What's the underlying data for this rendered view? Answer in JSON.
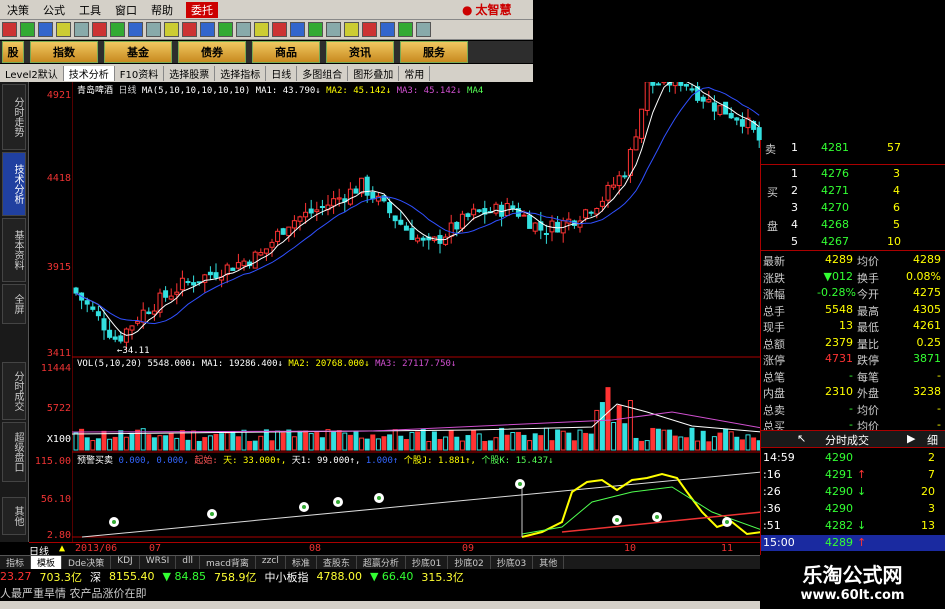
{
  "menu": {
    "items": [
      "决策",
      "公式",
      "工具",
      "窗口",
      "帮助"
    ],
    "highlight": "委托",
    "brand": "太智慧"
  },
  "nav": {
    "buttons": [
      "股",
      "指数",
      "基金",
      "债券",
      "商品",
      "资讯",
      "服务"
    ]
  },
  "tabs": {
    "items": [
      "Level2默认",
      "技术分析",
      "F10资料",
      "选择股票",
      "选择指标",
      "日线",
      "多图组合",
      "图形叠加",
      "常用"
    ]
  },
  "left_tabs": [
    "分时走势",
    "技术分析",
    "基本资料",
    "全屏",
    "分时成交",
    "超级盘口",
    "其他"
  ],
  "price_axis": {
    "labels": [
      "4921",
      "4418",
      "3915",
      "3411"
    ],
    "vol_labels": [
      "11444",
      "5722",
      "X100"
    ],
    "ind_labels": [
      "115.00",
      "56.10",
      "2.80"
    ]
  },
  "main_legend": {
    "name": "青岛啤酒",
    "period": "日线",
    "ma_def": "MA(5,10,10,10,10,10)",
    "ma1": "MA1: 43.790↓",
    "ma2": "MA2: 45.142↓",
    "ma3": "MA3: 45.142↓",
    "ma4": "MA4"
  },
  "low_label": "34.11",
  "vol_legend": {
    "def": "VOL(5,10,20)",
    "v": "5548.000↓",
    "ma1": "MA1: 19286.400↓",
    "ma2": "MA2: 20768.000↓",
    "ma3": "MA3: 27117.750↓"
  },
  "ind_legend": {
    "name": "预警买卖",
    "v1": "0.000, 0.000,",
    "v2": "起始:",
    "v3": "天: 33.000↑,",
    "v4": "天1: 99.000↑,",
    "v5": "1.000↑",
    "v6": "个股J: 1.881↑,",
    "v7": "个股K: 15.437↓"
  },
  "date_axis": {
    "label": "日线",
    "dates": [
      "2013/06",
      "07",
      "08",
      "09",
      "10",
      "11"
    ]
  },
  "orderbook": {
    "asks": [
      {
        "n": "1",
        "p": "4281",
        "v": "57"
      }
    ],
    "bids": [
      {
        "n": "1",
        "p": "4276",
        "v": "3"
      },
      {
        "n": "2",
        "p": "4271",
        "v": "4"
      },
      {
        "n": "3",
        "p": "4270",
        "v": "6"
      },
      {
        "n": "4",
        "p": "4268",
        "v": "5"
      },
      {
        "n": "5",
        "p": "4267",
        "v": "10"
      }
    ],
    "sell_label": "卖",
    "buy_label": "买",
    "plate_label": "盘"
  },
  "quote": [
    {
      "k": "最新",
      "v": "4289",
      "k2": "均价",
      "v2": "4289"
    },
    {
      "k": "涨跌",
      "v": "▼012",
      "k2": "换手",
      "v2": "0.08%"
    },
    {
      "k": "涨幅",
      "v": "-0.28%",
      "k2": "今开",
      "v2": "4275"
    },
    {
      "k": "总手",
      "v": "5548",
      "k2": "最高",
      "v2": "4305"
    },
    {
      "k": "现手",
      "v": "13",
      "k2": "最低",
      "v2": "4261"
    },
    {
      "k": "总额",
      "v": "2379",
      "k2": "量比",
      "v2": "0.25"
    },
    {
      "k": "涨停",
      "v": "4731",
      "k2": "跌停",
      "v2": "3871"
    },
    {
      "k": "总笔",
      "v": "-",
      "k2": "每笔",
      "v2": "-"
    },
    {
      "k": "内盘",
      "v": "2310",
      "k2": "外盘",
      "v2": "3238"
    },
    {
      "k": "总卖",
      "v": "-",
      "k2": "均价",
      "v2": "-"
    },
    {
      "k": "总买",
      "v": "-",
      "k2": "均价",
      "v2": "-"
    }
  ],
  "ticks_header": {
    "title": "分时成交",
    "next": "▶",
    "detail": "细"
  },
  "ticks": [
    {
      "t": "14:59",
      "p": "4290",
      "d": "",
      "v": "2"
    },
    {
      "t": ":16",
      "p": "4291",
      "d": "↑",
      "v": "7"
    },
    {
      "t": ":26",
      "p": "4290",
      "d": "↓",
      "v": "20"
    },
    {
      "t": ":36",
      "p": "4290",
      "d": "",
      "v": "3"
    },
    {
      "t": ":51",
      "p": "4282",
      "d": "↓",
      "v": "13"
    },
    {
      "t": "15:00",
      "p": "4289",
      "d": "↑",
      "v": ""
    }
  ],
  "bottom_tabs": [
    "指标",
    "模板",
    "Dde决策",
    "KDJ",
    "WRSI",
    "dll",
    "macd背离",
    "zzcl",
    "标准",
    "查股东",
    "超赢分析",
    "抄底01",
    "抄底02",
    "抄底03",
    "其他"
  ],
  "ticker": [
    {
      "v": "23.27",
      "c": "#f33"
    },
    {
      "v": "703.3亿",
      "c": "#ff3"
    },
    {
      "v": "深",
      "c": "#fff"
    },
    {
      "v": "8155.40",
      "c": "#ff3"
    },
    {
      "v": "▼ 84.85",
      "c": "#3f3"
    },
    {
      "v": "758.9亿",
      "c": "#ff3"
    },
    {
      "v": "中小板指",
      "c": "#fff"
    },
    {
      "v": "4788.00",
      "c": "#ff3"
    },
    {
      "v": "▼ 66.40",
      "c": "#3f3"
    },
    {
      "v": "315.3亿",
      "c": "#ff3"
    }
  ],
  "news": "人最严重旱情 农产品涨价在即",
  "watermark": {
    "line1": "乐淘公式网",
    "line2": "www.60lt.com"
  },
  "colors": {
    "up": "#ff3333",
    "down": "#33e0e0",
    "ma_white": "#ffffff",
    "ma_yellow": "#ffff00",
    "ma_purple": "#d050d0",
    "ma_green": "#50ff50"
  }
}
